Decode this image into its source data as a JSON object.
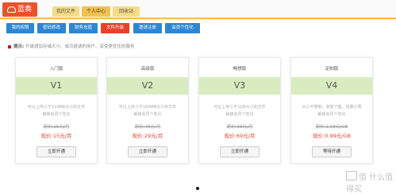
{
  "header": {
    "logo_text": "蓝奏",
    "tabs": [
      {
        "label": "我的文件"
      },
      {
        "label": "个人中心"
      },
      {
        "label": "回收站"
      }
    ]
  },
  "toolbar": {
    "buttons": [
      {
        "label": "我的权限"
      },
      {
        "label": "密码修改"
      },
      {
        "label": "财务充值"
      },
      {
        "label": "文件升级"
      },
      {
        "label": "邀请注册"
      },
      {
        "label": "会员个性化"
      }
    ]
  },
  "tip": {
    "label": "提示:",
    "text": "升级增加存储大小、成功邀请的用户、享受更优化的服务"
  },
  "plans": [
    {
      "name": "入门版",
      "version": "V1",
      "desc1": "可以上传小于110MB大小的文件",
      "desc2": "解锁会员个性化",
      "orig": "原价:25元/月",
      "now": "现价:15元/月",
      "button": "立即开通"
    },
    {
      "name": "高级版",
      "version": "V2",
      "desc1": "可以上传小于160MB大小的文件",
      "desc2": "解锁会员个性化",
      "orig": "原价:48元/月",
      "now": "现价:29元/月",
      "button": "立即开通"
    },
    {
      "name": "畅想版",
      "version": "V3",
      "desc1": "可以上传小于1GB大小的文件",
      "desc2": "解锁会员个性化",
      "orig": "原价:98元/月",
      "now": "现价:69元/月",
      "button": "立即开通"
    },
    {
      "name": "定制版",
      "version": "V4",
      "desc1": "大小不限制，单独下载、流量计费",
      "desc2": "解锁会员个性化",
      "orig": "原价:1.58元/GB",
      "now": "现价:0.99元/GB",
      "button": "等待开通"
    }
  ],
  "watermark": "值 什么值得买",
  "colors": {
    "brand": "#e9532c",
    "tab_active": "#f3c24e",
    "button_blue": "#2c86d4",
    "button_red": "#e8412b",
    "version_band": "#d9ecbf",
    "price": "#e8412b"
  }
}
